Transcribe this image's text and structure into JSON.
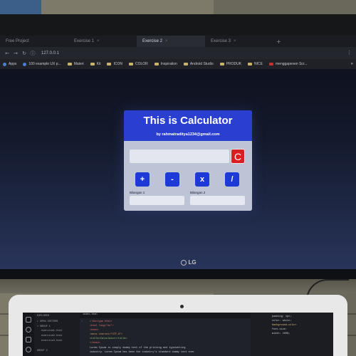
{
  "browser": {
    "tabs": [
      {
        "label": "Free Project"
      },
      {
        "label": "Exercise 1"
      },
      {
        "label": "Exercise 2"
      },
      {
        "label": "Exercise 3"
      }
    ],
    "url": "127.0.0.1",
    "bookmarks": [
      {
        "label": "Apps",
        "icon": "apps-icon"
      },
      {
        "label": "100 example UX p...",
        "icon": "globe-icon"
      },
      {
        "label": "Materi",
        "icon": "folder-icon"
      },
      {
        "label": "Kit",
        "icon": "folder-icon"
      },
      {
        "label": "ICON",
        "icon": "folder-icon"
      },
      {
        "label": "COLOR",
        "icon": "folder-icon"
      },
      {
        "label": "Inspiration",
        "icon": "folder-icon"
      },
      {
        "label": "Android Studio",
        "icon": "folder-icon"
      },
      {
        "label": "PRODUK",
        "icon": "folder-icon"
      },
      {
        "label": "NICE",
        "icon": "folder-icon"
      },
      {
        "label": "menggapeven Scr...",
        "icon": "red-icon"
      }
    ],
    "bookmarks_more": "»"
  },
  "calculator": {
    "title": "This is Calculator",
    "subtitle": "by rahmatraditya1234@gmail.com",
    "clear_label": "C",
    "operators": [
      "+",
      "-",
      "x",
      "/"
    ],
    "input1_label": "Bilangan 1",
    "input2_label": "Bilangan 2",
    "header_color": "#2a3fd0",
    "button_color": "#1d3ad8",
    "clear_color": "#d81e22"
  },
  "monitor": {
    "brand": "LG"
  },
  "laptop_editor": {
    "sidebar": [
      "EXPLORER",
      "▸ OPEN EDITORS",
      "▾ GROUP 1",
      "exercise1.html",
      "exercise2.html",
      "exercise3.html",
      "GROUP 2"
    ],
    "tab": "index.html",
    "lines": [
      "<!doctype html>",
      "<html lang=\"en\">",
      "<head>",
      "  <meta charset=\"UTF-8\">",
      "",
      "  <title>Calculator</title>",
      "</head>",
      "  Lorem Ipsum is simply dummy text of the printing and typesetting",
      "  industry. Lorem Ipsum has been the industry's standard dummy text ever"
    ],
    "right_lines": [
      "padding: 1px;",
      "color: white;",
      "background-color:",
      "font-size:",
      "width: 100%;"
    ]
  }
}
